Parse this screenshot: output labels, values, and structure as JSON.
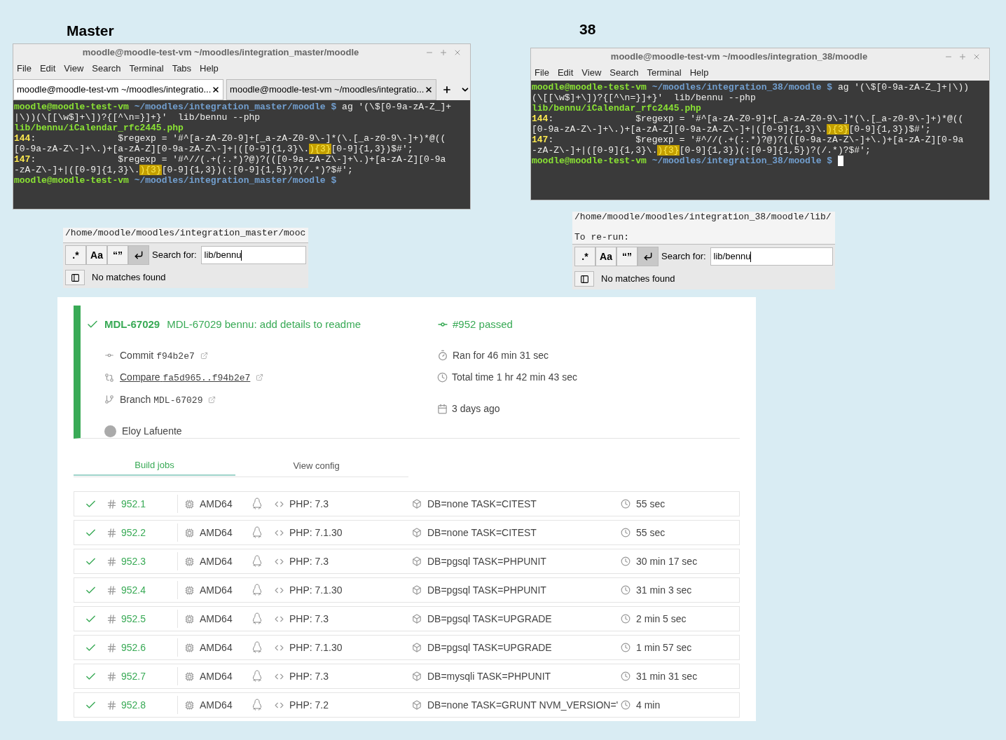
{
  "headings": [
    {
      "text": "Master"
    },
    {
      "text": "38"
    }
  ],
  "terminals": [
    {
      "title": "moodle@moodle-test-vm ~/moodles/integration_master/moodle",
      "menu": [
        "File",
        "Edit",
        "View",
        "Search",
        "Terminal",
        "Tabs",
        "Help"
      ],
      "tabs": [
        {
          "label": "moodle@moodle-test-vm ~/moodles/integratio...",
          "selected": true
        },
        {
          "label": "moodle@moodle-test-vm ~/moodles/integratio...",
          "selected": false
        }
      ],
      "lines": [
        [
          {
            "kind": "user",
            "text": "moodle@moodle-test-vm"
          },
          {
            "kind": "path",
            "text": " ~/moodles/integration_master/moodle $"
          },
          {
            "kind": "plain",
            "text": " ag '(\\$[0-9a-zA-Z_]+"
          }
        ],
        [
          {
            "kind": "plain",
            "text": "|\\))(\\[[\\w$]+\\])?{[^\\n=}]+}'  lib/bennu --php"
          }
        ],
        [
          {
            "kind": "file",
            "text": "lib/bennu/iCalendar_rfc2445.php"
          }
        ],
        [
          {
            "kind": "number",
            "text": "144"
          },
          {
            "kind": "plain",
            "text": ":               $regexp = '#^[a-zA-Z0-9]+[_a-zA-Z0-9\\-]*(\\.[_a-z0-9\\-]+)*@(("
          }
        ],
        [
          {
            "kind": "plain",
            "text": "[0-9a-zA-Z\\-]+\\.)+[a-zA-Z][0-9a-zA-Z\\-]+|([0-9]{1,3}\\."
          },
          {
            "kind": "match",
            "text": "){3}"
          },
          {
            "kind": "plain",
            "text": "[0-9]{1,3})$#';"
          }
        ],
        [
          {
            "kind": "number",
            "text": "147"
          },
          {
            "kind": "plain",
            "text": ":               $regexp = '#^//(.+(:.*)?@)?(([0-9a-zA-Z\\-]+\\.)+[a-zA-Z][0-9a"
          }
        ],
        [
          {
            "kind": "plain",
            "text": "-zA-Z\\-]+|([0-9]{1,3}\\."
          },
          {
            "kind": "match",
            "text": "){3}"
          },
          {
            "kind": "plain",
            "text": "[0-9]{1,3})(:[0-9]{1,5})?(/.*)?$#';"
          }
        ],
        [
          {
            "kind": "user",
            "text": "moodle@moodle-test-vm"
          },
          {
            "kind": "path",
            "text": " ~/moodles/integration_master/moodle $"
          }
        ]
      ],
      "cursor": false
    },
    {
      "title": "moodle@moodle-test-vm ~/moodles/integration_38/moodle",
      "menu": [
        "File",
        "Edit",
        "View",
        "Search",
        "Terminal",
        "Help"
      ],
      "lines": [
        [
          {
            "kind": "user",
            "text": "moodle@moodle-test-vm"
          },
          {
            "kind": "path",
            "text": " ~/moodles/integration_38/moodle $"
          },
          {
            "kind": "plain",
            "text": " ag '(\\$[0-9a-zA-Z_]+|\\))"
          }
        ],
        [
          {
            "kind": "plain",
            "text": "(\\[[\\w$]+\\])?{[^\\n=}]+}'  lib/bennu --php"
          }
        ],
        [
          {
            "kind": "file",
            "text": "lib/bennu/iCalendar_rfc2445.php"
          }
        ],
        [
          {
            "kind": "number",
            "text": "144"
          },
          {
            "kind": "plain",
            "text": ":               $regexp = '#^[a-zA-Z0-9]+[_a-zA-Z0-9\\-]*(\\.[_a-z0-9\\-]+)*@(("
          }
        ],
        [
          {
            "kind": "plain",
            "text": "[0-9a-zA-Z\\-]+\\.)+[a-zA-Z][0-9a-zA-Z\\-]+|([0-9]{1,3}\\."
          },
          {
            "kind": "match",
            "text": "){3}"
          },
          {
            "kind": "plain",
            "text": "[0-9]{1,3})$#';"
          }
        ],
        [
          {
            "kind": "number",
            "text": "147"
          },
          {
            "kind": "plain",
            "text": ":               $regexp = '#^//(.+(:.*)?@)?(([0-9a-zA-Z\\-]+\\.)+[a-zA-Z][0-9a"
          }
        ],
        [
          {
            "kind": "plain",
            "text": "-zA-Z\\-]+|([0-9]{1,3}\\."
          },
          {
            "kind": "match",
            "text": "){3}"
          },
          {
            "kind": "plain",
            "text": "[0-9]{1,3})(:[0-9]{1,5})?(/.*)?$#';"
          }
        ],
        [
          {
            "kind": "user",
            "text": "moodle@moodle-test-vm"
          },
          {
            "kind": "path",
            "text": " ~/moodles/integration_38/moodle $"
          }
        ]
      ],
      "cursor": true
    }
  ],
  "search_panels": [
    {
      "log_lines": [
        "/home/moodle/moodles/integration_master/mooc"
      ],
      "toggles": [
        {
          "kind": "text",
          "label": ".*",
          "selected": false
        },
        {
          "kind": "text",
          "label": "Aa",
          "selected": false
        },
        {
          "kind": "text",
          "label": "“”",
          "selected": false
        },
        {
          "kind": "wrap",
          "selected": true
        }
      ],
      "label": "Search for:",
      "value": "lib/bennu",
      "status": "No matches found"
    },
    {
      "log_lines": [
        "/home/moodle/moodles/integration_38/moodle/lib/",
        "To re-run:"
      ],
      "toggles": [
        {
          "kind": "text",
          "label": ".*",
          "selected": false
        },
        {
          "kind": "text",
          "label": "Aa",
          "selected": false
        },
        {
          "kind": "text",
          "label": "“”",
          "selected": false
        },
        {
          "kind": "wrap",
          "selected": true
        }
      ],
      "label": "Search for:",
      "value": "lib/bennu",
      "status": "No matches found"
    }
  ],
  "build": {
    "branch": "MDL-67029",
    "message": "MDL-67029 bennu: add details to readme",
    "result": "#952 passed",
    "details": [
      {
        "kind": "commit",
        "label": "Commit",
        "code": "f94b2e7"
      },
      {
        "kind": "compare",
        "label": "Compare",
        "code": "fa5d965..f94b2e7"
      },
      {
        "kind": "branch",
        "label": "Branch",
        "code": "MDL-67029"
      }
    ],
    "author": "Eloy Lafuente",
    "ran": "Ran for 46 min 31 sec",
    "total": "Total time 1 hr 42 min 43 sec",
    "ago": "3 days ago",
    "tabs": [
      {
        "label": "Build jobs",
        "selected": true
      },
      {
        "label": "View config",
        "selected": false
      }
    ],
    "jobs": [
      {
        "number": "952.1",
        "arch": "AMD64",
        "php": "PHP: 7.3",
        "env": "DB=none TASK=CITEST",
        "duration": "55 sec"
      },
      {
        "number": "952.2",
        "arch": "AMD64",
        "php": "PHP: 7.1.30",
        "env": "DB=none TASK=CITEST",
        "duration": "55 sec"
      },
      {
        "number": "952.3",
        "arch": "AMD64",
        "php": "PHP: 7.3",
        "env": "DB=pgsql TASK=PHPUNIT",
        "duration": "30 min 17 sec"
      },
      {
        "number": "952.4",
        "arch": "AMD64",
        "php": "PHP: 7.1.30",
        "env": "DB=pgsql TASK=PHPUNIT",
        "duration": "31 min 3 sec"
      },
      {
        "number": "952.5",
        "arch": "AMD64",
        "php": "PHP: 7.3",
        "env": "DB=pgsql TASK=UPGRADE",
        "duration": "2 min 5 sec"
      },
      {
        "number": "952.6",
        "arch": "AMD64",
        "php": "PHP: 7.1.30",
        "env": "DB=pgsql TASK=UPGRADE",
        "duration": "1 min 57 sec"
      },
      {
        "number": "952.7",
        "arch": "AMD64",
        "php": "PHP: 7.3",
        "env": "DB=mysqli TASK=PHPUNIT",
        "duration": "31 min 31 sec"
      },
      {
        "number": "952.8",
        "arch": "AMD64",
        "php": "PHP: 7.2",
        "env": "DB=none TASK=GRUNT NVM_VERSION='",
        "duration": "4 min"
      }
    ]
  }
}
